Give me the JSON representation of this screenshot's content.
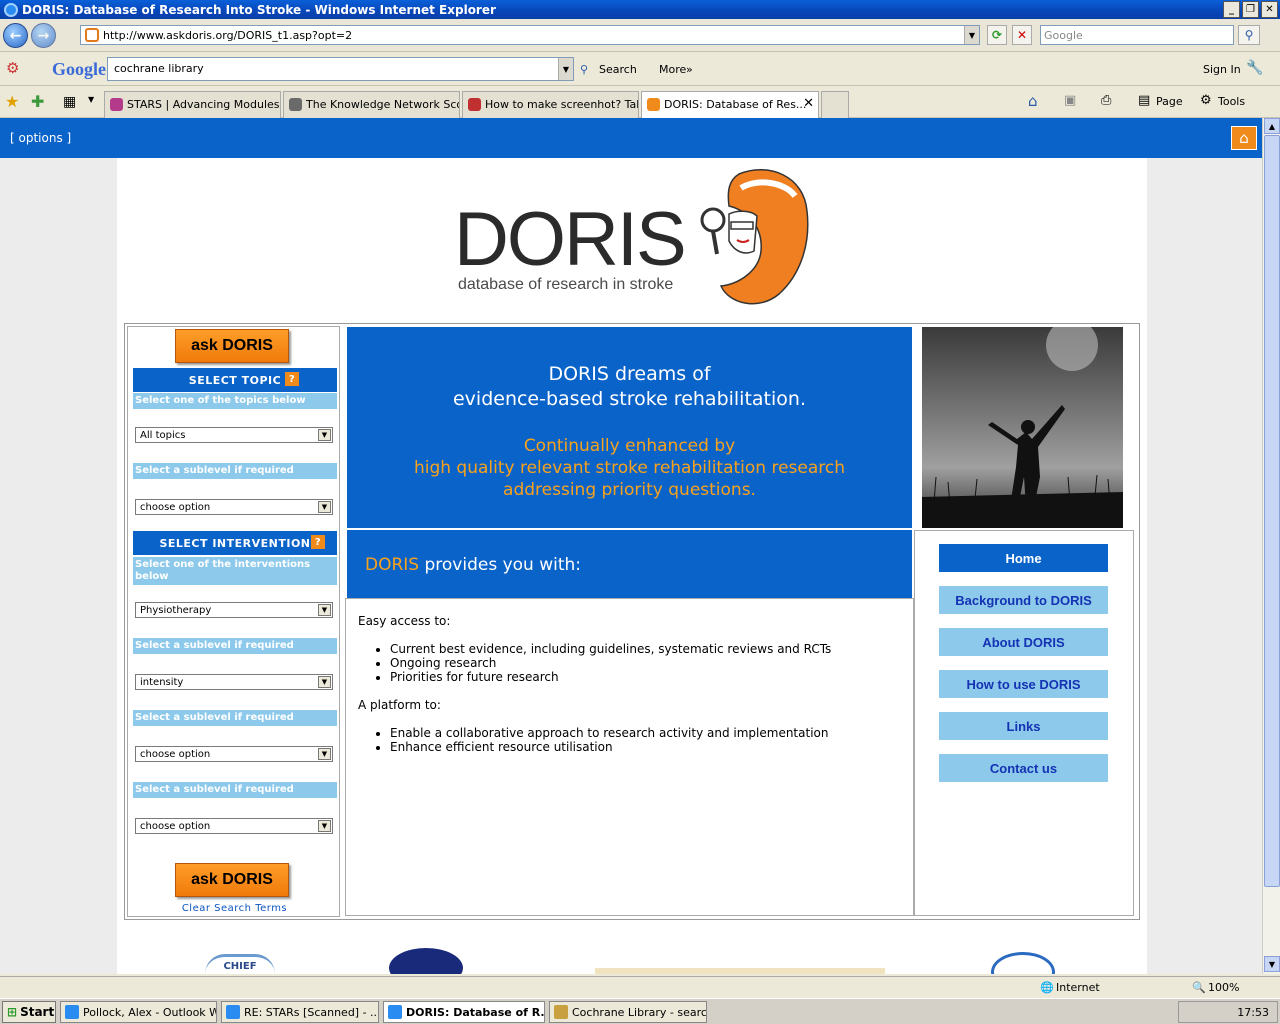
{
  "window": {
    "title": "DORIS: Database of Research Into Stroke - Windows Internet Explorer"
  },
  "address": {
    "url": "http://www.askdoris.org/DORIS_t1.asp?opt=2",
    "search_placeholder": "Google"
  },
  "google_toolbar": {
    "logo": "Google",
    "query": "cochrane library",
    "search_label": "Search",
    "more_label": "More",
    "sign_in": "Sign In"
  },
  "tabs": [
    {
      "label": "STARS | Advancing Modules ..."
    },
    {
      "label": "The Knowledge Network Sco..."
    },
    {
      "label": "How to make screenhot? Tak..."
    },
    {
      "label": "DORIS: Database of Res..."
    }
  ],
  "tab_commands": {
    "page": "Page",
    "tools": "Tools"
  },
  "page": {
    "options_link": "[ options ]",
    "logo_word": "DORIS",
    "logo_subtitle": "database of research in stroke",
    "left": {
      "ask_button": "ask DORIS",
      "topic_header": "SELECT TOPIC",
      "topic_hint": "Select one of the topics below",
      "topic_select": "All topics",
      "sublevel_hint": "Select a sublevel if required",
      "choose_option": "choose option",
      "intervention_header": "SELECT INTERVENTION",
      "intervention_hint": "Select one of the interventions below",
      "intervention_select": "Physiotherapy",
      "intensity_select": "intensity",
      "help_icon": "?",
      "clear_link": "Clear Search Terms"
    },
    "hero": {
      "line1": "DORIS dreams of",
      "line2": "evidence-based stroke rehabilitation.",
      "line3": "Continually enhanced by",
      "line4": "high quality relevant stroke rehabilitation research",
      "line5": "addressing priority questions."
    },
    "provides": {
      "brand": "DORIS",
      "text": " provides you with:"
    },
    "content": {
      "easy_access": "Easy access to:",
      "easy_items": [
        "Current best evidence, including guidelines, systematic reviews and RCTs",
        "Ongoing research",
        "Priorities for future research"
      ],
      "platform": "A platform to:",
      "platform_items": [
        "Enable a collaborative approach to research activity and implementation",
        "Enhance efficient resource utilisation"
      ]
    },
    "nav": [
      "Home",
      "Background to DORIS",
      "About DORIS",
      "How to use DORIS",
      "Links",
      "Contact us"
    ],
    "footer_logo_text": "CHIEF"
  },
  "status": {
    "zone": "Internet",
    "zoom": "100%"
  },
  "taskbar": {
    "start": "Start",
    "items": [
      "Pollock, Alex - Outlook W...",
      "RE: STARs [Scanned] - ...",
      "DORIS: Database of R...",
      "Cochrane Library - searc..."
    ],
    "clock": "17:53"
  },
  "colors": {
    "accent_blue": "#0a63c9",
    "accent_orange": "#f08a1a",
    "light_blue": "#8dc9ea"
  }
}
